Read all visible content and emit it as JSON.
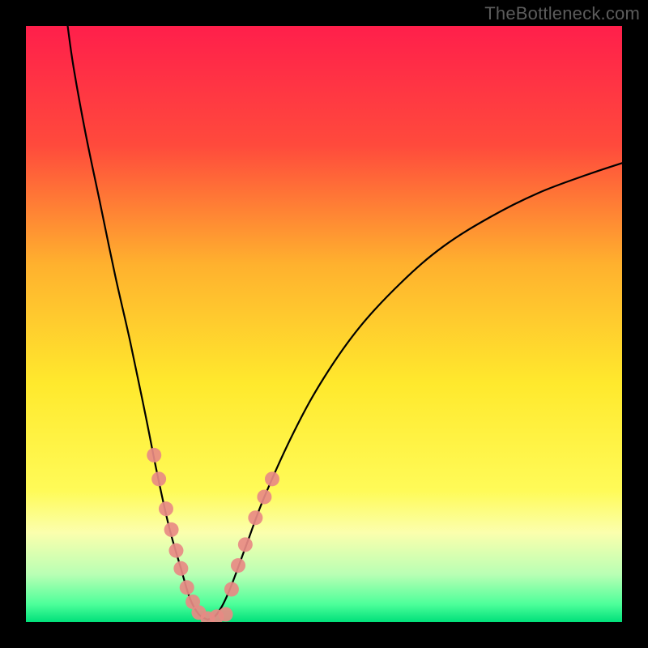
{
  "watermark": "TheBottleneck.com",
  "chart_data": {
    "type": "line",
    "title": "",
    "xlabel": "",
    "ylabel": "",
    "xlim": [
      0,
      100
    ],
    "ylim": [
      0,
      100
    ],
    "legend": false,
    "grid": false,
    "gradient_stops": [
      {
        "offset": 0.0,
        "color": "#ff1f4b"
      },
      {
        "offset": 0.2,
        "color": "#ff4a3c"
      },
      {
        "offset": 0.4,
        "color": "#ffb12e"
      },
      {
        "offset": 0.6,
        "color": "#ffe92d"
      },
      {
        "offset": 0.78,
        "color": "#fffb58"
      },
      {
        "offset": 0.85,
        "color": "#fbffad"
      },
      {
        "offset": 0.92,
        "color": "#b9ffb4"
      },
      {
        "offset": 0.97,
        "color": "#4dff9a"
      },
      {
        "offset": 1.0,
        "color": "#00e07a"
      }
    ],
    "series": [
      {
        "name": "left-curve",
        "type": "line",
        "color": "#000000",
        "points": [
          {
            "x": 7.0,
            "y": 100.0
          },
          {
            "x": 8.0,
            "y": 93.0
          },
          {
            "x": 10.0,
            "y": 82.0
          },
          {
            "x": 12.5,
            "y": 70.0
          },
          {
            "x": 15.0,
            "y": 58.0
          },
          {
            "x": 17.5,
            "y": 47.0
          },
          {
            "x": 20.0,
            "y": 35.0
          },
          {
            "x": 22.0,
            "y": 25.0
          },
          {
            "x": 24.0,
            "y": 16.0
          },
          {
            "x": 26.0,
            "y": 9.0
          },
          {
            "x": 27.5,
            "y": 4.0
          },
          {
            "x": 29.0,
            "y": 1.3
          },
          {
            "x": 30.5,
            "y": 0.4
          }
        ]
      },
      {
        "name": "right-curve",
        "type": "line",
        "color": "#000000",
        "points": [
          {
            "x": 30.5,
            "y": 0.4
          },
          {
            "x": 32.0,
            "y": 1.3
          },
          {
            "x": 34.0,
            "y": 5.0
          },
          {
            "x": 37.0,
            "y": 13.0
          },
          {
            "x": 40.0,
            "y": 21.0
          },
          {
            "x": 45.0,
            "y": 32.0
          },
          {
            "x": 50.0,
            "y": 41.0
          },
          {
            "x": 56.0,
            "y": 49.5
          },
          {
            "x": 63.0,
            "y": 57.0
          },
          {
            "x": 70.0,
            "y": 63.0
          },
          {
            "x": 78.0,
            "y": 68.0
          },
          {
            "x": 86.0,
            "y": 72.0
          },
          {
            "x": 94.0,
            "y": 75.0
          },
          {
            "x": 100.0,
            "y": 77.0
          }
        ]
      },
      {
        "name": "markers",
        "type": "scatter",
        "color": "#e88a84",
        "points": [
          {
            "x": 21.5,
            "y": 28.0
          },
          {
            "x": 22.3,
            "y": 24.0
          },
          {
            "x": 23.5,
            "y": 19.0
          },
          {
            "x": 24.4,
            "y": 15.5
          },
          {
            "x": 25.2,
            "y": 12.0
          },
          {
            "x": 26.0,
            "y": 9.0
          },
          {
            "x": 27.0,
            "y": 5.8
          },
          {
            "x": 28.0,
            "y": 3.4
          },
          {
            "x": 29.0,
            "y": 1.6
          },
          {
            "x": 30.5,
            "y": 0.6
          },
          {
            "x": 32.0,
            "y": 0.9
          },
          {
            "x": 33.5,
            "y": 1.3
          },
          {
            "x": 34.5,
            "y": 5.5
          },
          {
            "x": 35.6,
            "y": 9.5
          },
          {
            "x": 36.8,
            "y": 13.0
          },
          {
            "x": 38.5,
            "y": 17.5
          },
          {
            "x": 40.0,
            "y": 21.0
          },
          {
            "x": 41.3,
            "y": 24.0
          }
        ]
      }
    ]
  }
}
